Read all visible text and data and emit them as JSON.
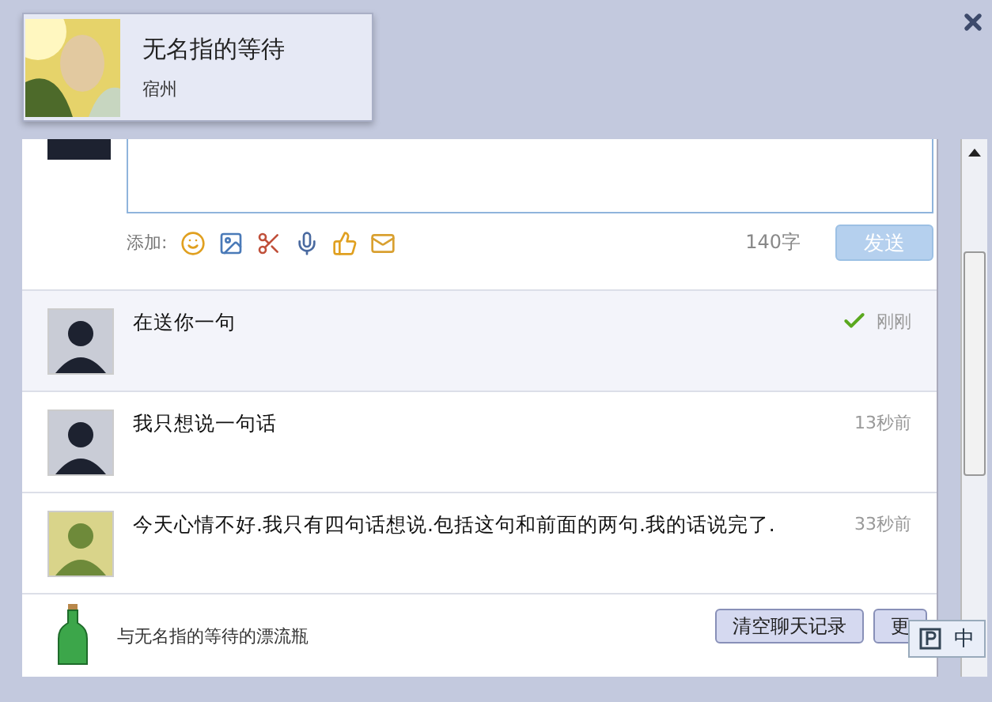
{
  "header": {
    "name": "无名指的等待",
    "location": "宿州"
  },
  "composer": {
    "add_label": "添加:",
    "char_count": "140字",
    "send_button": "发送",
    "send_disabled": true
  },
  "messages": [
    {
      "kind": "self",
      "text": "在送你一句",
      "time": "刚刚",
      "highlighted": true,
      "delivered": true
    },
    {
      "kind": "self",
      "text": "我只想说一句话",
      "time": "13秒前",
      "highlighted": false,
      "delivered": false
    },
    {
      "kind": "friend",
      "text": "今天心情不好.我只有四句话想说.包括这句和前面的两句.我的话说完了.",
      "time": "33秒前",
      "highlighted": false,
      "delivered": false
    }
  ],
  "footer": {
    "title": "与无名指的等待的漂流瓶",
    "buttons": [
      "清空聊天记录",
      "更"
    ]
  },
  "ime": {
    "label": "中"
  }
}
